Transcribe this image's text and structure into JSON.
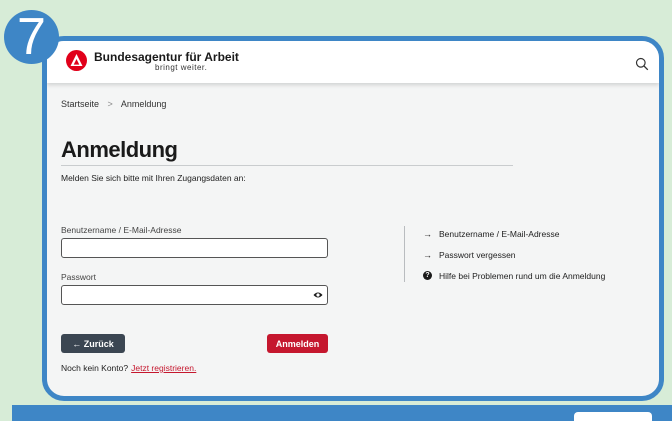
{
  "step_badge": "7",
  "header": {
    "brand_name": "Bundesagentur für Arbeit",
    "brand_slogan": "bringt weiter.",
    "logo_icon": "ba-logo-icon",
    "search_icon": "search-icon",
    "brand_color": "#e1001a"
  },
  "breadcrumb": {
    "home": "Startseite",
    "separator": ">",
    "current": "Anmeldung"
  },
  "main": {
    "title": "Anmeldung",
    "subtitle": "Melden Sie sich bitte mit Ihren Zugangsdaten an:",
    "username": {
      "label": "Benutzername / E-Mail-Adresse",
      "value": "",
      "placeholder": ""
    },
    "password": {
      "label": "Passwort",
      "value": "",
      "placeholder": ""
    },
    "back_button": "← Zurück",
    "login_button": "Anmelden",
    "no_account_text": "Noch kein Konto?",
    "register_link": "Jetzt registrieren."
  },
  "help_links": [
    {
      "icon": "arrow-right-icon",
      "label": "Benutzername / E-Mail-Adresse"
    },
    {
      "icon": "arrow-right-icon",
      "label": "Passwort vergessen"
    },
    {
      "icon": "help-icon",
      "label": "Hilfe bei Problemen rund um die Anmeldung"
    }
  ],
  "colors": {
    "frame_blue": "#3e86c6",
    "background_green": "#d7ecd7",
    "primary_red": "#c5172e",
    "dark_button": "#3b4652"
  }
}
